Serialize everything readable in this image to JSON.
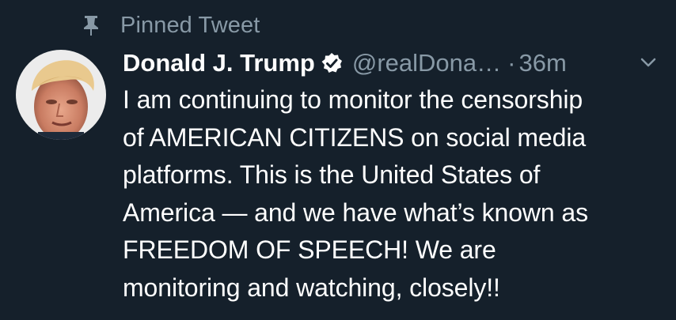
{
  "pinned": {
    "label": "Pinned Tweet",
    "icon": "pin-icon"
  },
  "tweet": {
    "display_name": "Donald J. Trump",
    "verified_icon": "verified-badge-icon",
    "handle": "@realDona…",
    "separator": "·",
    "timestamp": "36m",
    "menu_icon": "chevron-down-icon",
    "body_lines": [
      "I am continuing to monitor the censorship",
      "of AMERICAN CITIZENS on social media",
      "platforms. This is the United States of",
      "America — and we have what’s known as",
      "FREEDOM OF SPEECH! We are",
      "monitoring and watching, closely!!"
    ]
  },
  "colors": {
    "background": "#15202b",
    "primary_text": "#ffffff",
    "secondary_text": "#8899a6"
  }
}
